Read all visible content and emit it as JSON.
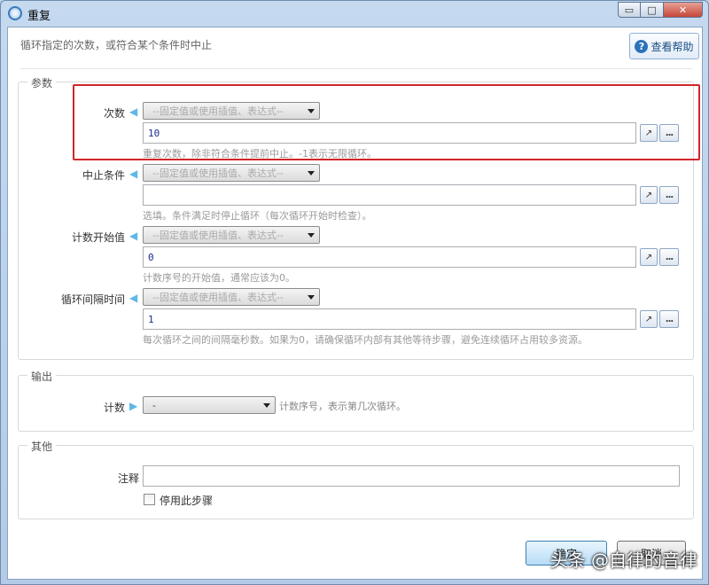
{
  "window": {
    "title": "重复",
    "minimize_glyph": "▭",
    "maximize_glyph": "□",
    "close_glyph": "✕"
  },
  "header": {
    "description": "循环指定的次数，或符合某个条件时中止",
    "help_label": "查看帮助",
    "help_glyph": "?"
  },
  "params": {
    "group_title": "参数",
    "combo_placeholder": "--固定值或使用插值、表达式--",
    "rows": [
      {
        "label": "次数",
        "value": "10",
        "hint": "重复次数，除非符合条件提前中止。-1表示无限循环。"
      },
      {
        "label": "中止条件",
        "value": "",
        "hint": "选填。条件满足时停止循环（每次循环开始时检查）。"
      },
      {
        "label": "计数开始值",
        "value": "0",
        "hint": "计数序号的开始值，通常应该为0。"
      },
      {
        "label": "循环间隔时间",
        "value": "1",
        "hint": "每次循环之间的间隔毫秒数。如果为0，请确保循环内部有其他等待步骤，避免连续循环占用较多资源。"
      }
    ],
    "expand_glyph": "↗",
    "more_glyph": "..."
  },
  "output": {
    "group_title": "输出",
    "label": "计数",
    "combo_value": "-",
    "hint": "计数序号，表示第几次循环。"
  },
  "other": {
    "group_title": "其他",
    "note_label": "注释",
    "note_value": "",
    "disable_label": "停用此步骤",
    "disable_checked": false
  },
  "footer": {
    "ok_label": "确定",
    "cancel_label": "取消"
  },
  "watermark": "头条 @自律的音律",
  "colors": {
    "arrow": "#5fb8e6",
    "highlight": "#d1262b",
    "title_bar": "#c5d9ef"
  }
}
